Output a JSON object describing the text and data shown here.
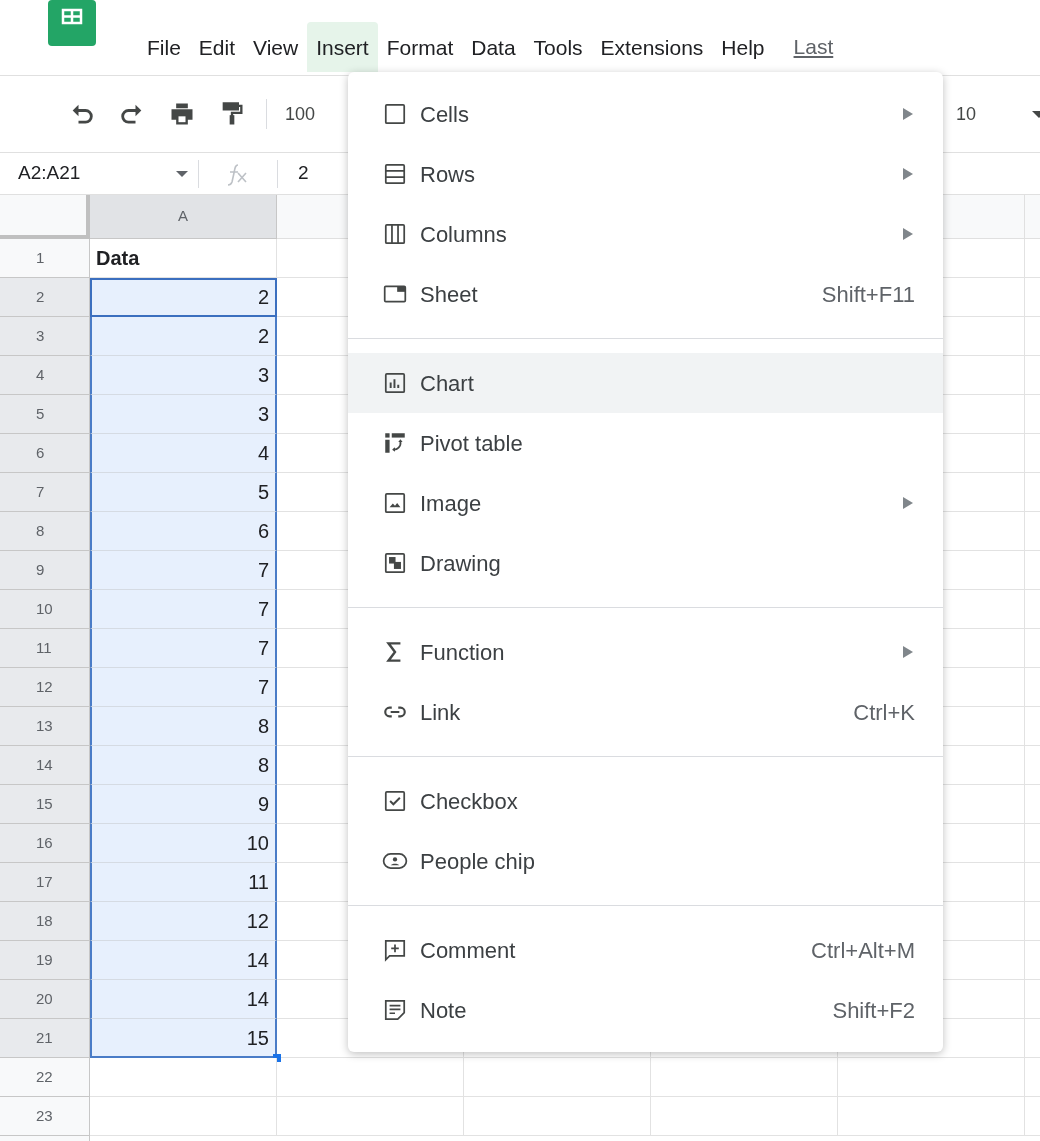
{
  "menu_bar": [
    {
      "label": "File",
      "selected": false
    },
    {
      "label": "Edit",
      "selected": false
    },
    {
      "label": "View",
      "selected": false
    },
    {
      "label": "Insert",
      "selected": true
    },
    {
      "label": "Format",
      "selected": false
    },
    {
      "label": "Data",
      "selected": false
    },
    {
      "label": "Tools",
      "selected": false
    },
    {
      "label": "Extensions",
      "selected": false
    },
    {
      "label": "Help",
      "selected": false
    }
  ],
  "last_edit_link": "Last",
  "toolbar": {
    "zoom": "100",
    "font_size": "10"
  },
  "formula_bar": {
    "name_box": "A2:A21",
    "value": "2"
  },
  "sheet": {
    "column_header": {
      "label": "A",
      "selected": true
    },
    "rows": [
      {
        "number": "1",
        "value": "Data",
        "bold": true,
        "selected": false,
        "active": false
      },
      {
        "number": "2",
        "value": "2",
        "bold": false,
        "selected": true,
        "active": true
      },
      {
        "number": "3",
        "value": "2",
        "bold": false,
        "selected": true,
        "active": false
      },
      {
        "number": "4",
        "value": "3",
        "bold": false,
        "selected": true,
        "active": false
      },
      {
        "number": "5",
        "value": "3",
        "bold": false,
        "selected": true,
        "active": false
      },
      {
        "number": "6",
        "value": "4",
        "bold": false,
        "selected": true,
        "active": false
      },
      {
        "number": "7",
        "value": "5",
        "bold": false,
        "selected": true,
        "active": false
      },
      {
        "number": "8",
        "value": "6",
        "bold": false,
        "selected": true,
        "active": false
      },
      {
        "number": "9",
        "value": "7",
        "bold": false,
        "selected": true,
        "active": false
      },
      {
        "number": "10",
        "value": "7",
        "bold": false,
        "selected": true,
        "active": false
      },
      {
        "number": "11",
        "value": "7",
        "bold": false,
        "selected": true,
        "active": false
      },
      {
        "number": "12",
        "value": "7",
        "bold": false,
        "selected": true,
        "active": false
      },
      {
        "number": "13",
        "value": "8",
        "bold": false,
        "selected": true,
        "active": false
      },
      {
        "number": "14",
        "value": "8",
        "bold": false,
        "selected": true,
        "active": false
      },
      {
        "number": "15",
        "value": "9",
        "bold": false,
        "selected": true,
        "active": false
      },
      {
        "number": "16",
        "value": "10",
        "bold": false,
        "selected": true,
        "active": false
      },
      {
        "number": "17",
        "value": "11",
        "bold": false,
        "selected": true,
        "active": false
      },
      {
        "number": "18",
        "value": "12",
        "bold": false,
        "selected": true,
        "active": false
      },
      {
        "number": "19",
        "value": "14",
        "bold": false,
        "selected": true,
        "active": false
      },
      {
        "number": "20",
        "value": "14",
        "bold": false,
        "selected": true,
        "active": false
      },
      {
        "number": "21",
        "value": "15",
        "bold": false,
        "selected": true,
        "active": false
      },
      {
        "number": "22",
        "selected": false,
        "active": false
      },
      {
        "number": "23",
        "selected": false,
        "active": false
      }
    ]
  },
  "insert_menu": {
    "groups": [
      {
        "items": [
          {
            "label": "Cells",
            "submenu": true,
            "highlighted": false
          },
          {
            "label": "Rows",
            "submenu": true,
            "highlighted": false
          },
          {
            "label": "Columns",
            "submenu": true,
            "highlighted": false
          },
          {
            "label": "Sheet",
            "shortcut": "Shift+F11",
            "submenu": false,
            "highlighted": false
          }
        ]
      },
      {
        "items": [
          {
            "label": "Chart",
            "submenu": false,
            "highlighted": true
          },
          {
            "label": "Pivot table",
            "submenu": false,
            "highlighted": false
          },
          {
            "label": "Image",
            "submenu": true,
            "highlighted": false
          },
          {
            "label": "Drawing",
            "submenu": false,
            "highlighted": false
          }
        ]
      },
      {
        "items": [
          {
            "label": "Function",
            "submenu": true,
            "highlighted": false
          },
          {
            "label": "Link",
            "shortcut": "Ctrl+K",
            "submenu": false,
            "highlighted": false
          }
        ]
      },
      {
        "items": [
          {
            "label": "Checkbox",
            "submenu": false,
            "highlighted": false
          },
          {
            "label": "People chip",
            "submenu": false,
            "highlighted": false
          }
        ]
      },
      {
        "items": [
          {
            "label": "Comment",
            "shortcut": "Ctrl+Alt+M",
            "submenu": false,
            "highlighted": false
          },
          {
            "label": "Note",
            "shortcut": "Shift+F2",
            "submenu": false,
            "highlighted": false
          }
        ]
      }
    ]
  }
}
